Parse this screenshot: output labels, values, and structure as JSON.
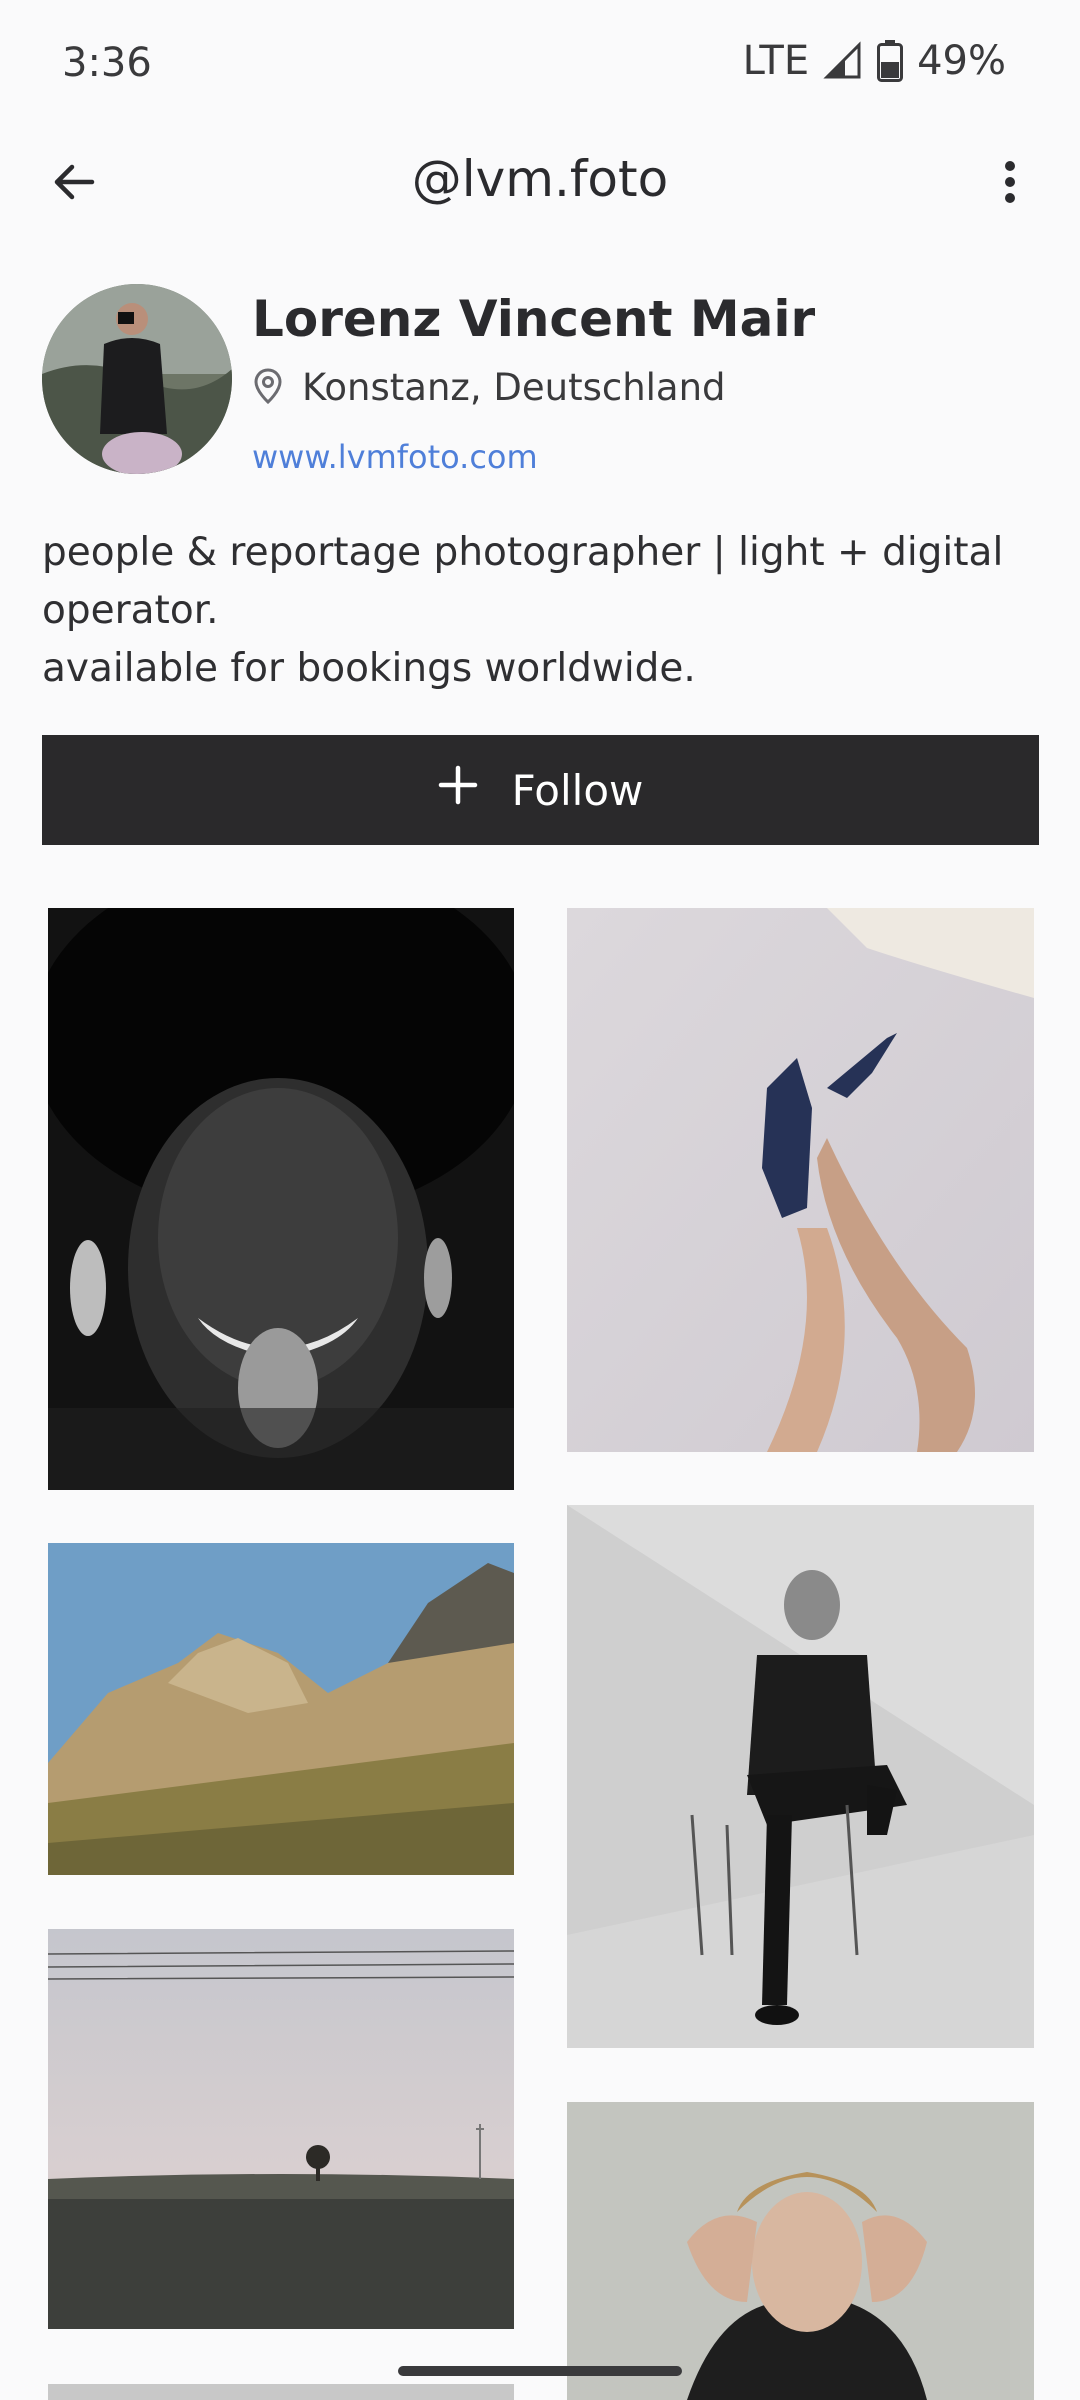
{
  "status_bar": {
    "time": "3:36",
    "network": "LTE",
    "battery": "49%",
    "icons": [
      "signal-icon",
      "battery-icon"
    ]
  },
  "app_bar": {
    "title": "@lvm.foto",
    "back_icon": "arrow-back-icon",
    "more_icon": "more-vert-icon"
  },
  "profile": {
    "name": "Lorenz Vincent Mair",
    "location": "Konstanz, Deutschland",
    "location_icon": "location-pin-icon",
    "website": "www.lvmfoto.com",
    "bio_lines": [
      "people & reportage photographer | light + digital",
      "operator.",
      "available for bookings worldwide."
    ]
  },
  "follow_button": {
    "label": "Follow",
    "icon": "plus-icon"
  },
  "colors": {
    "background": "#fafafb",
    "button": "#2a292b",
    "link": "#4f7fd9",
    "text": "#2b2b2e"
  }
}
